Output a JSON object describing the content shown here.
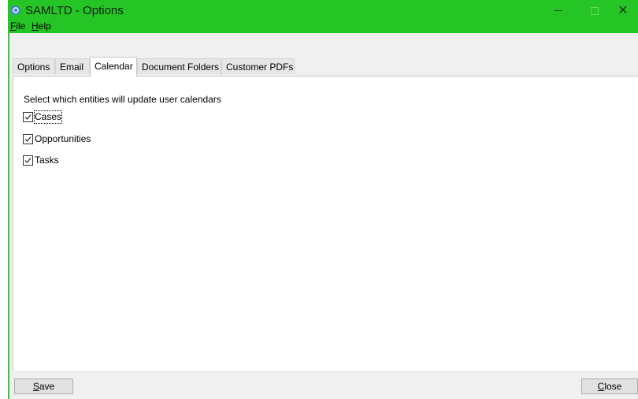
{
  "window": {
    "title": "SAMLTD - Options",
    "close_glyph": "✕",
    "colors": {
      "titlebar": "#26c526",
      "panel": "#ffffff",
      "chrome": "#f0f0f0"
    }
  },
  "menu": {
    "file_mnemonic": "F",
    "file_rest": "ile",
    "help_mnemonic": "H",
    "help_rest": "elp"
  },
  "tabs": [
    {
      "label": "Options",
      "active": false
    },
    {
      "label": "Email",
      "active": false
    },
    {
      "label": "Calendar",
      "active": true
    },
    {
      "label": "Document Folders",
      "active": false
    },
    {
      "label": "Customer PDFs",
      "active": false
    }
  ],
  "calendar": {
    "instructions": "Select which entities will update user calendars",
    "options": [
      {
        "label": "Cases",
        "checked": true
      },
      {
        "label": "Opportunities",
        "checked": true
      },
      {
        "label": "Tasks",
        "checked": true
      }
    ]
  },
  "buttons": {
    "save_mnemonic": "S",
    "save_rest": "ave",
    "close_mnemonic": "C",
    "close_rest": "lose"
  },
  "icons": {
    "app": "app-logo-icon",
    "minimize": "minimize-icon",
    "maximize": "maximize-icon",
    "close": "close-icon",
    "check": "checkmark-icon"
  }
}
